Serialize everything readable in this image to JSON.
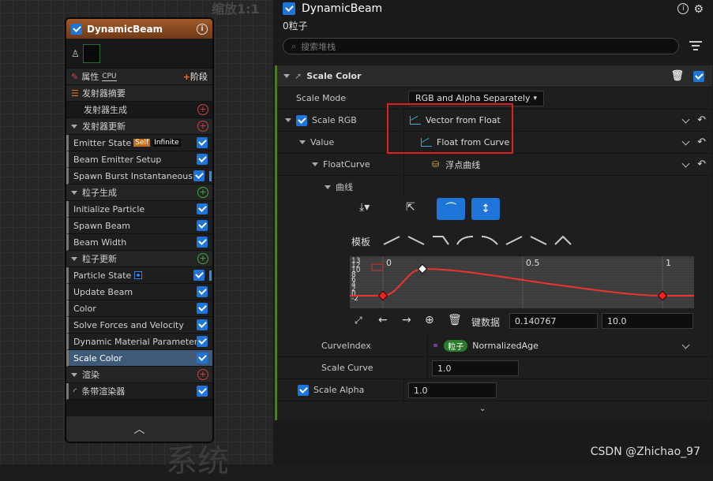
{
  "graph": {
    "zoom_label": "缩放1:1",
    "watermark": "系统"
  },
  "node": {
    "title": "DynamicBeam",
    "props_label": "属性",
    "cpu_label": "CPU",
    "stage_label": "阶段",
    "summary_label": "发射器摘要",
    "rows": [
      {
        "kind": "plain",
        "label": "发射器生成",
        "plus": "red"
      },
      {
        "kind": "sec",
        "label": "发射器更新",
        "plus": "red"
      },
      {
        "kind": "mod",
        "label": "Emitter State",
        "badges": [
          "Self",
          "Infinite"
        ]
      },
      {
        "kind": "mod",
        "label": "Beam Emitter Setup"
      },
      {
        "kind": "mod",
        "label": "Spawn Burst Instantaneous",
        "dot": true
      },
      {
        "kind": "sec",
        "label": "粒子生成",
        "plus": "green"
      },
      {
        "kind": "mod",
        "label": "Initialize Particle"
      },
      {
        "kind": "mod",
        "label": "Spawn Beam"
      },
      {
        "kind": "mod",
        "label": "Beam Width"
      },
      {
        "kind": "sec",
        "label": "粒子更新",
        "plus": "green"
      },
      {
        "kind": "mod",
        "label": "Particle State",
        "dot": true
      },
      {
        "kind": "mod",
        "label": "Update Beam"
      },
      {
        "kind": "mod",
        "label": "Color"
      },
      {
        "kind": "mod",
        "label": "Solve Forces and Velocity"
      },
      {
        "kind": "mod",
        "label": "Dynamic Material Parameters"
      },
      {
        "kind": "mod",
        "label": "Scale Color",
        "selected": true
      },
      {
        "kind": "sec",
        "label": "渲染",
        "plus": "red"
      },
      {
        "kind": "mod",
        "label": "条带渲染器"
      }
    ]
  },
  "panel": {
    "title": "DynamicBeam",
    "count": "0粒子",
    "search_placeholder": "搜索堆栈",
    "category": "Scale Color",
    "scale_mode_label": "Scale Mode",
    "scale_mode_value": "RGB and Alpha Separately",
    "scale_rgb_label": "Scale RGB",
    "scale_rgb_value": "Vector from Float",
    "value_label": "Value",
    "value_value": "Float from Curve",
    "floatcurve_label": "FloatCurve",
    "floatcurve_value": "浮点曲线",
    "curve_label": "曲线",
    "templates_label": "模板",
    "key_label": "键数据",
    "key_time": "0.140767",
    "key_value": "10.0",
    "curve_index_label": "CurveIndex",
    "curve_index_pill": "粒子",
    "curve_index_value": "NormalizedAge",
    "scale_curve_label": "Scale Curve",
    "scale_curve_value": "1.0",
    "scale_alpha_label": "Scale Alpha",
    "scale_alpha_value": "1.0"
  },
  "curve_axis": {
    "x_ticks": [
      "0",
      "0.5",
      "1"
    ],
    "y_ticks": [
      "13",
      "12",
      "10",
      "8",
      "6",
      "4",
      "2",
      "0",
      "-2"
    ]
  },
  "csdn": "CSDN @Zhichao_97"
}
